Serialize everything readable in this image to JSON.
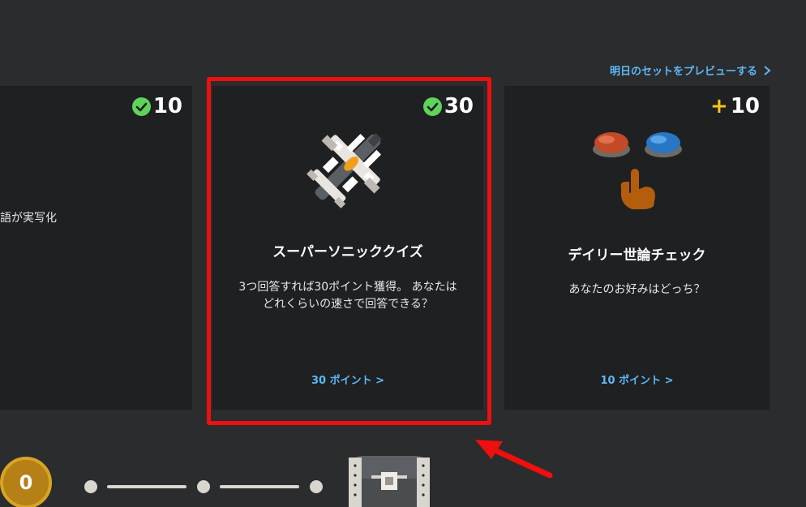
{
  "header": {
    "preview_link": "明日のセットをプレビューする",
    "preview_icon": "chevron-right-icon"
  },
  "cards": [
    {
      "id": "left",
      "badge_points": "10",
      "badge_icon": "check-circle-icon",
      "partial_text": "語が実写化"
    },
    {
      "id": "supersonic",
      "badge_points": "30",
      "badge_icon": "check-circle-icon",
      "illustration": "supersonic-jet-icon",
      "title": "スーパーソニッククイズ",
      "desc_line1": "3つ回答すれば30ポイント獲得。 あなたは",
      "desc_line2": "どれくらいの速さで回答できる？",
      "points_link": "30 ポイント >"
    },
    {
      "id": "daily-poll",
      "badge_prefix": "+",
      "badge_points": "10",
      "illustration": "two-buttons-pointer-icon",
      "title": "デイリー世論チェック",
      "desc_line1": "あなたのお好みはどっち？",
      "points_link": "10 ポイント >"
    }
  ],
  "progress": {
    "coin_value": "0",
    "reward_icon": "treasure-chest-icon"
  },
  "colors": {
    "background": "#2a2c2e",
    "card": "#1e2022",
    "link_blue": "#5fb8f5",
    "check_green": "#5fd35a",
    "highlight_red": "#ee0f0f",
    "coin_gold": "#b58016",
    "plus_yellow": "#f5c518"
  }
}
